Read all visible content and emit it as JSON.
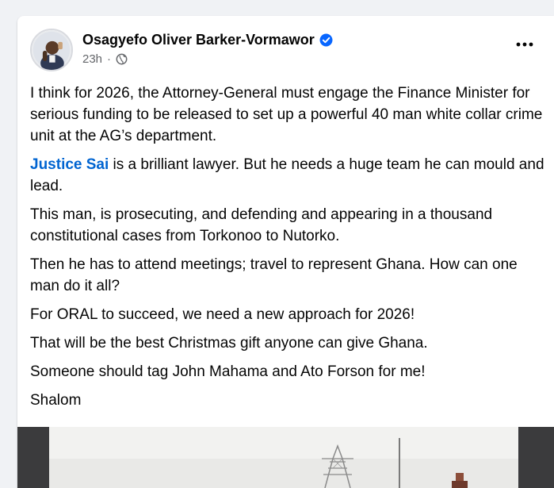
{
  "post": {
    "author": "Osagyefo Oliver Barker-Vormawor",
    "time": "23h",
    "time_separator": "·",
    "more_label": "···",
    "paragraphs": [
      {
        "text": "I think for 2026, the Attorney-General must engage the Finance Minister for serious funding to be released to set up a powerful 40 man white collar crime unit at the AG’s department."
      },
      {
        "mention": "Justice Sai",
        "text": " is a  brilliant lawyer. But he needs a huge team he can mould and lead."
      },
      {
        "text": "This man, is prosecuting, and defending and appearing in a thousand constitutional cases from Torkonoo to Nutorko."
      },
      {
        "text": "Then he has to attend meetings; travel to represent Ghana. How can one man do it all?"
      },
      {
        "text": "For ORAL to succeed, we need a new approach for 2026!"
      },
      {
        "text": "That will be the best Christmas gift anyone can give Ghana."
      },
      {
        "text": "Someone should tag John Mahama and Ato Forson for me!"
      },
      {
        "text": "Shalom"
      }
    ],
    "icons": {
      "verified": "verified-badge-icon",
      "audience": "globe-icon",
      "more": "more-horizontal-icon"
    },
    "colors": {
      "mention": "#0064d1",
      "verified": "#0866ff",
      "background": "#f0f2f5"
    }
  }
}
